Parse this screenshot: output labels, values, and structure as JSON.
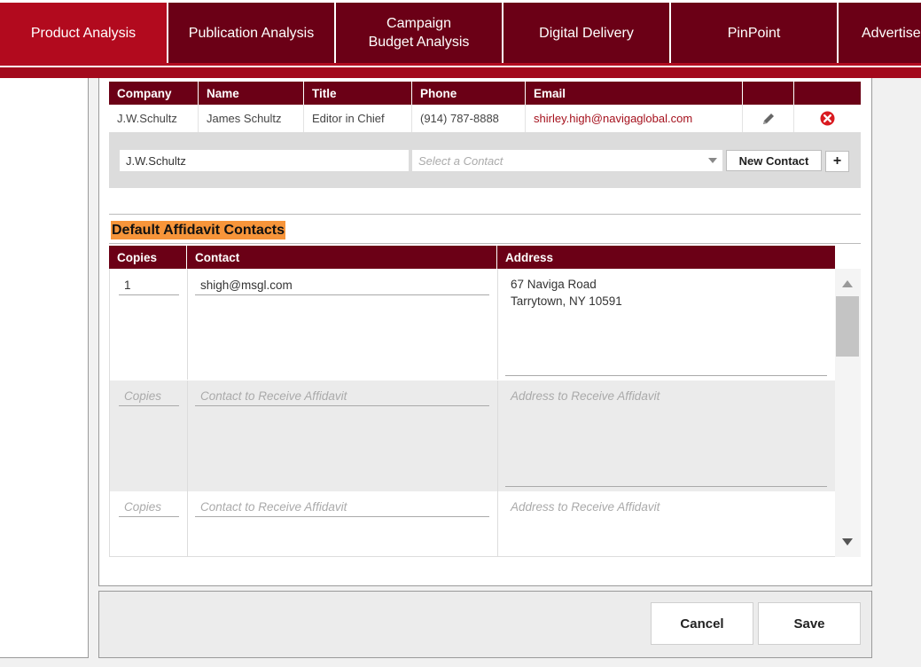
{
  "tabs": [
    {
      "label": "Product Analysis",
      "active": true
    },
    {
      "label": "Publication Analysis",
      "active": false
    },
    {
      "label": "Campaign Budget Analysis",
      "active": false
    },
    {
      "label": "Digital Delivery",
      "active": false
    },
    {
      "label": "PinPoint",
      "active": false
    },
    {
      "label": "Advertise",
      "active": false
    }
  ],
  "contacts": {
    "headers": [
      "Company",
      "Name",
      "Title",
      "Phone",
      "Email"
    ],
    "rows": [
      {
        "company": "J.W.Schultz",
        "name": "James Schultz",
        "title": "Editor in Chief",
        "phone": "(914) 787-8888",
        "email": "shirley.high@navigaglobal.com"
      }
    ],
    "company_input": "J.W.Schultz",
    "contact_select_placeholder": "Select a Contact",
    "new_contact_label": "New Contact",
    "add_label": "+"
  },
  "affidavit": {
    "title": "Default Affidavit Contacts",
    "headers": [
      "Copies",
      "Contact",
      "Address"
    ],
    "rows": [
      {
        "copies": "1",
        "contact": "shigh@msgl.com",
        "address_line1": "67 Naviga Road",
        "address_line2": "Tarrytown, NY 10591"
      }
    ],
    "placeholder_copies": "Copies",
    "placeholder_contact": "Contact to Receive Affidavit",
    "placeholder_address": "Address to Receive Affidavit"
  },
  "footer": {
    "cancel_label": "Cancel",
    "save_label": "Save"
  },
  "colors": {
    "tab_bg": "#6b0016",
    "tab_active": "#b20a1e",
    "header_bg": "#6b0016",
    "highlight": "#f7953a",
    "link": "#a5111d"
  }
}
